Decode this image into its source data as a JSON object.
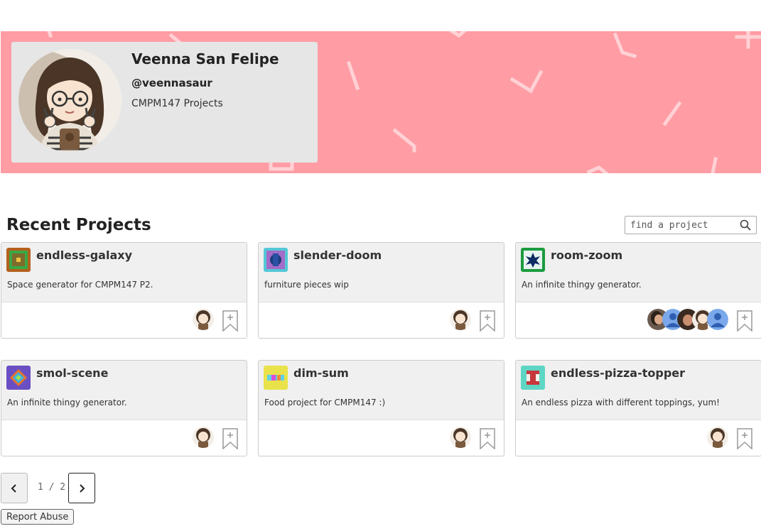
{
  "profile": {
    "name": "Veenna San Felipe",
    "handle": "@veennasaur",
    "description": "CMPM147 Projects"
  },
  "section": {
    "title": "Recent Projects"
  },
  "search": {
    "placeholder": "find a project"
  },
  "projects": [
    {
      "title": "endless-galaxy",
      "description": "Space generator for CMPM147 P2.",
      "thumb_colors": [
        "#b5601e",
        "#3aa845"
      ]
    },
    {
      "title": "slender-doom",
      "description": "furniture pieces wip",
      "thumb_colors": [
        "#a46cc9",
        "#54c7d6"
      ]
    },
    {
      "title": "room-zoom",
      "description": "An infinite thingy generator.",
      "thumb_colors": [
        "#1c9b3f",
        "#0e2b63"
      ]
    },
    {
      "title": "smol-scene",
      "description": "An infinite thingy generator.",
      "thumb_colors": [
        "#6a4fc2",
        "#e8732c"
      ]
    },
    {
      "title": "dim-sum",
      "description": "Food project for CMPM147 :)",
      "thumb_colors": [
        "#e9e24b",
        "#d94fd5"
      ]
    },
    {
      "title": "endless-pizza-topper",
      "description": "An endless pizza with different toppings, yum!",
      "thumb_colors": [
        "#5fd6c4",
        "#c7383c"
      ]
    }
  ],
  "pagination": {
    "label": "1 / 2"
  },
  "footer": {
    "report_label": "Report Abuse"
  },
  "colors": {
    "banner": "#ff9ca4",
    "card_header": "#f0f0f0",
    "profile_card": "#e6e6e6"
  }
}
